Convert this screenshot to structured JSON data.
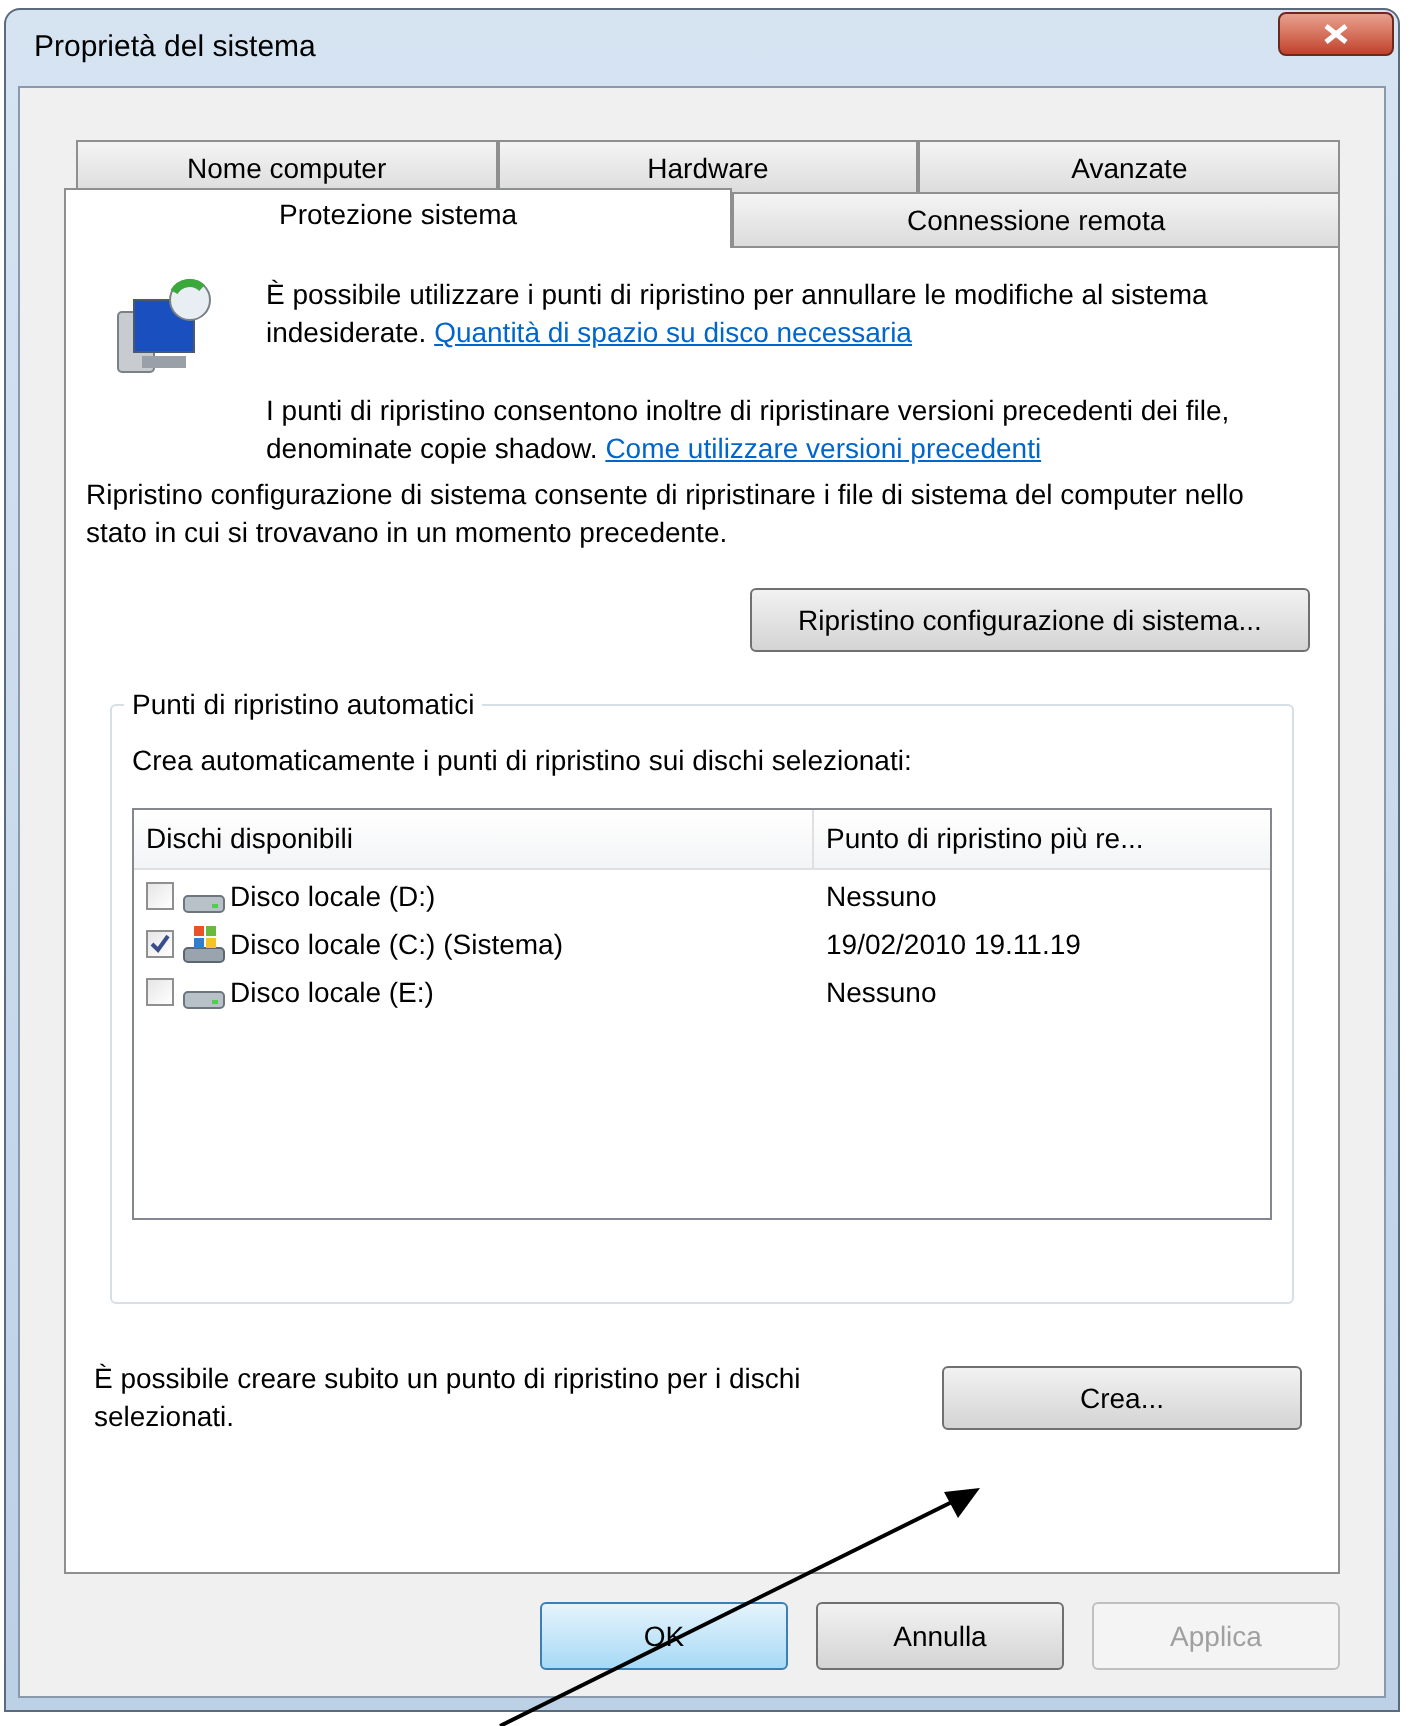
{
  "window": {
    "title": "Proprietà del sistema"
  },
  "tab_rows": [
    [
      {
        "label": "Nome computer",
        "selected": false
      },
      {
        "label": "Hardware",
        "selected": false
      },
      {
        "label": "Avanzate",
        "selected": false
      }
    ],
    [
      {
        "label": "Protezione sistema",
        "selected": true
      },
      {
        "label": "Connessione remota",
        "selected": false
      }
    ]
  ],
  "intro": {
    "text": "È possibile utilizzare i punti di ripristino per annullare le modifiche al sistema indesiderate.",
    "link": "Quantità di spazio su disco necessaria"
  },
  "shadow": {
    "text": "I punti di ripristino consentono inoltre di ripristinare versioni precedenti dei file, denominate copie shadow.",
    "link": "Come utilizzare versioni precedenti"
  },
  "description": "Ripristino configurazione di sistema consente di ripristinare i file di sistema del computer nello stato in cui si trovavano in un momento precedente.",
  "restore_button": "Ripristino configurazione di sistema...",
  "group": {
    "title": "Punti di ripristino automatici",
    "caption": "Crea automaticamente i punti di ripristino sui dischi selezionati:",
    "columns": [
      "Dischi disponibili",
      "Punto di ripristino più re..."
    ],
    "rows": [
      {
        "kind": "drive",
        "checked": false,
        "name": "Disco locale (D:)",
        "restore_point": "Nessuno"
      },
      {
        "kind": "system",
        "checked": true,
        "name": "Disco locale (C:) (Sistema)",
        "restore_point": "19/02/2010 19.11.19"
      },
      {
        "kind": "drive",
        "checked": false,
        "name": "Disco locale (E:)",
        "restore_point": "Nessuno"
      }
    ]
  },
  "create": {
    "text": "È possibile creare subito un punto di ripristino per i dischi selezionati.",
    "button": "Crea..."
  },
  "buttons": [
    {
      "label": "OK",
      "kind": "default",
      "disabled": false
    },
    {
      "label": "Annulla",
      "kind": "normal",
      "disabled": false
    },
    {
      "label": "Applica",
      "kind": "normal",
      "disabled": true
    }
  ]
}
